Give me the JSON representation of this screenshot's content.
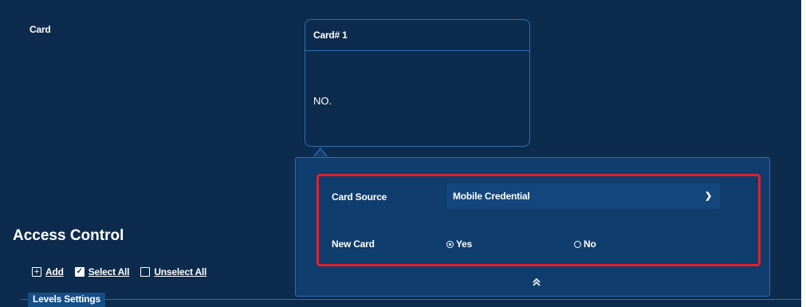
{
  "card": {
    "label": "Card",
    "box_title": "Card# 1",
    "number_label": "NO."
  },
  "popover": {
    "card_source_label": "Card Source",
    "card_source_value": "Mobile Credential",
    "new_card_label": "New Card",
    "yes_label": "Yes",
    "no_label": "No",
    "new_card_selected": "Yes",
    "collapse_icon": "double-chevron-up-icon"
  },
  "access": {
    "title": "Access Control",
    "add_label": "Add",
    "select_all_label": "Select All",
    "unselect_all_label": "Unselect All",
    "levels_title": "Levels Settings"
  },
  "colors": {
    "panel_bg": "#0d2b4c",
    "popover_bg": "#0f3d6d",
    "border": "#2b6fb5",
    "highlight": "#e0202a"
  }
}
